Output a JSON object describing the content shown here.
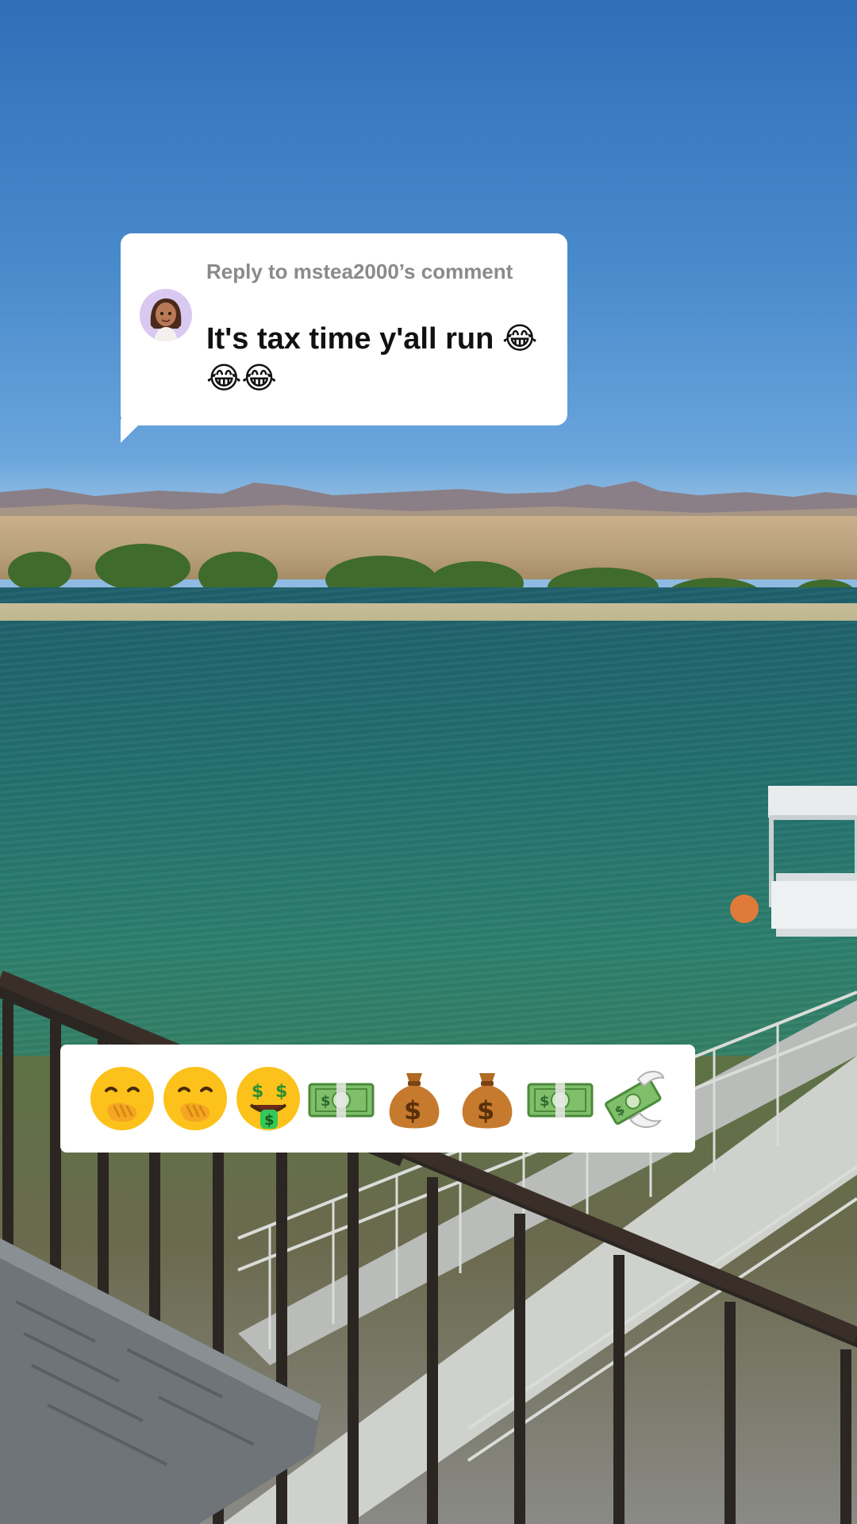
{
  "reply": {
    "header": "Reply to mstea2000’s comment",
    "text": "It's tax time y'all run 😂😂😂",
    "avatar": "avatar-icon"
  },
  "caption": {
    "emojis": [
      "face-with-hand-over-mouth-icon",
      "face-with-hand-over-mouth-icon",
      "money-mouth-face-icon",
      "dollar-banknote-icon",
      "money-bag-icon",
      "money-bag-icon",
      "dollar-banknote-icon",
      "money-with-wings-icon"
    ]
  },
  "colors": {
    "sky": "#2f6fb8",
    "water": "#23706f",
    "bubble": "#ffffff",
    "header_text": "#8a8a8a",
    "body_text": "#111111"
  }
}
